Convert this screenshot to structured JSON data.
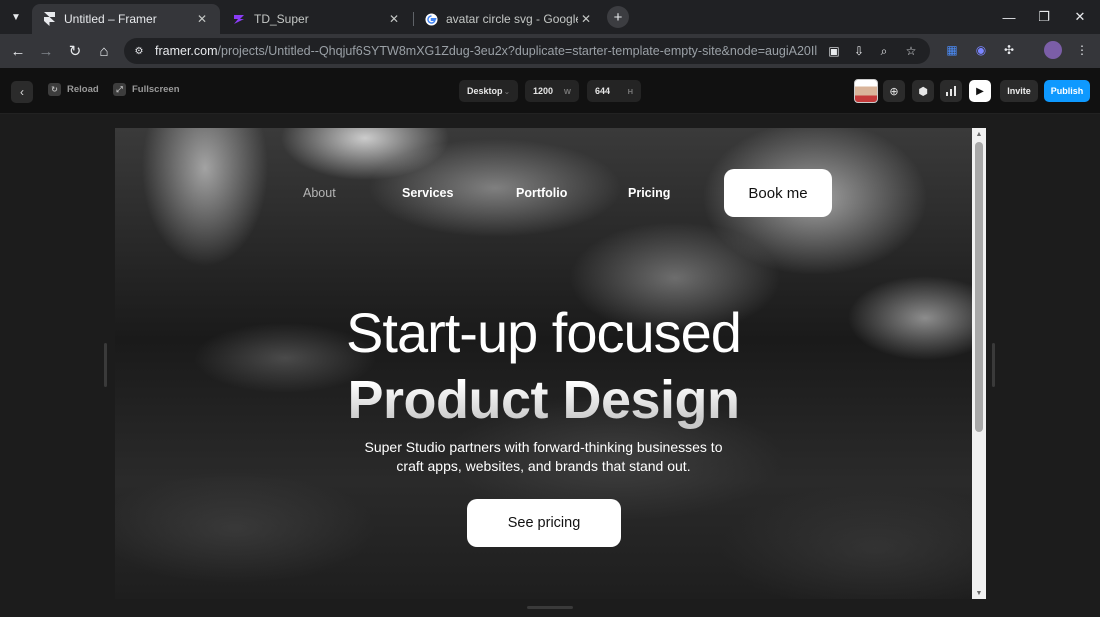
{
  "browser": {
    "tabs": [
      {
        "title": "Untitled – Framer",
        "icon": "framer-icon",
        "active": true
      },
      {
        "title": "TD_Super",
        "icon": "td-super-icon",
        "active": false
      },
      {
        "title": "avatar circle svg - Google Search",
        "icon": "google-icon",
        "active": false
      }
    ],
    "url_host": "framer.com",
    "url_path": "/projects/Untitled--Qhqjuf6SYTW8mXG1Zdug-3eu2x?duplicate=starter-template-empty-site&node=augiA20Il"
  },
  "framer_toolbar": {
    "reload_label": "Reload",
    "fullscreen_label": "Fullscreen",
    "breakpoint": "Desktop",
    "width_value": "1200",
    "width_unit": "W",
    "height_value": "644",
    "height_unit": "H",
    "invite_label": "Invite",
    "publish_label": "Publish",
    "publish_color": "#0e99ff"
  },
  "site": {
    "nav": {
      "about": "About",
      "services": "Services",
      "portfolio": "Portfolio",
      "pricing": "Pricing",
      "cta": "Book me"
    },
    "hero": {
      "line1": "Start-up focused",
      "line2": "Product Design",
      "sub_line1": "Super Studio partners with forward-thinking businesses to",
      "sub_line2": "craft apps, websites, and brands that stand out.",
      "cta": "See pricing"
    }
  }
}
